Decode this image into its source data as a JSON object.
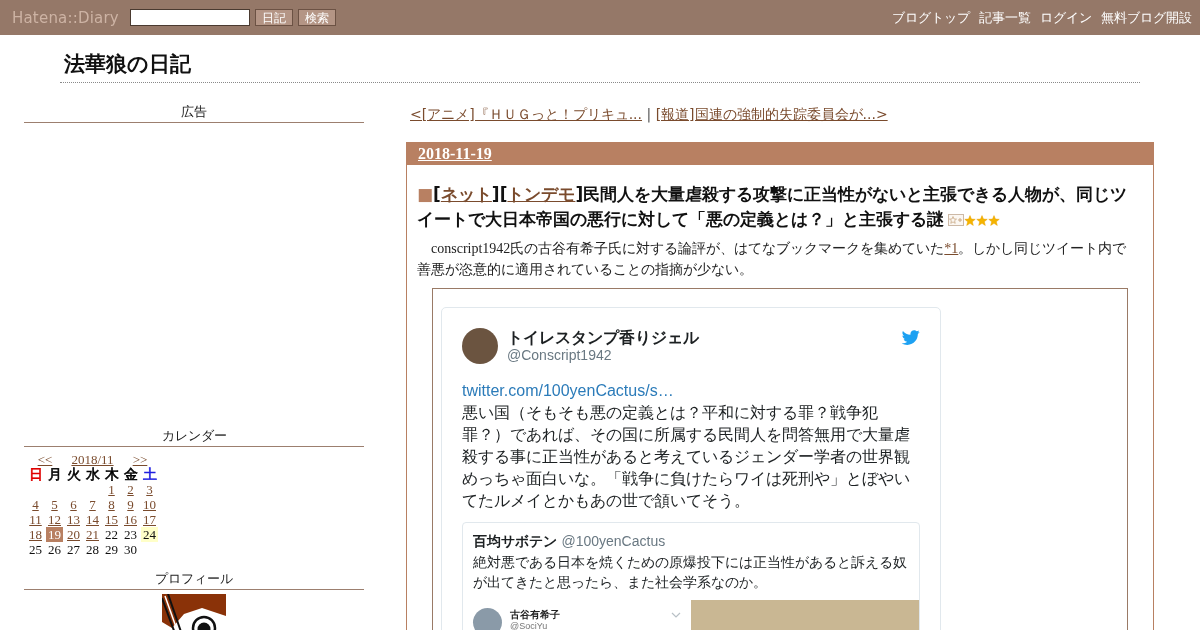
{
  "header": {
    "logo": "Hatena::Diary",
    "buttons": [
      "日記",
      "検索"
    ],
    "links": [
      "ブログトップ",
      "記事一覧",
      "ログイン",
      "無料ブログ開設"
    ]
  },
  "blog_title": "法華狼の日記",
  "sidebar": {
    "ad": {
      "heading": "広告"
    },
    "calendar": {
      "heading": "カレンダー",
      "prev": "<<",
      "month": "2018/11",
      "next": ">>",
      "weekdays": [
        {
          "label": "日",
          "color": "#e00000"
        },
        {
          "label": "月",
          "color": "#000000"
        },
        {
          "label": "火",
          "color": "#000000"
        },
        {
          "label": "水",
          "color": "#000000"
        },
        {
          "label": "木",
          "color": "#000000"
        },
        {
          "label": "金",
          "color": "#000000"
        },
        {
          "label": "土",
          "color": "#2020e0"
        }
      ],
      "weeks": [
        [
          {
            "day": "1",
            "linked": true,
            "selected": false,
            "today": false
          },
          {
            "day": "2",
            "linked": true,
            "selected": false,
            "today": false
          },
          {
            "day": "3",
            "linked": true,
            "selected": false,
            "today": false
          }
        ],
        [
          {
            "day": "4",
            "linked": true,
            "selected": false,
            "today": false
          },
          {
            "day": "5",
            "linked": true,
            "selected": false,
            "today": false
          },
          {
            "day": "6",
            "linked": true,
            "selected": false,
            "today": false
          },
          {
            "day": "7",
            "linked": true,
            "selected": false,
            "today": false
          },
          {
            "day": "8",
            "linked": true,
            "selected": false,
            "today": false
          },
          {
            "day": "9",
            "linked": true,
            "selected": false,
            "today": false
          },
          {
            "day": "10",
            "linked": true,
            "selected": false,
            "today": false
          }
        ],
        [
          {
            "day": "11",
            "linked": true,
            "selected": false,
            "today": false
          },
          {
            "day": "12",
            "linked": true,
            "selected": false,
            "today": false
          },
          {
            "day": "13",
            "linked": true,
            "selected": false,
            "today": false
          },
          {
            "day": "14",
            "linked": true,
            "selected": false,
            "today": false
          },
          {
            "day": "15",
            "linked": true,
            "selected": false,
            "today": false
          },
          {
            "day": "16",
            "linked": true,
            "selected": false,
            "today": false
          },
          {
            "day": "17",
            "linked": true,
            "selected": false,
            "today": false
          }
        ],
        [
          {
            "day": "18",
            "linked": true,
            "selected": false,
            "today": false
          },
          {
            "day": "19",
            "linked": true,
            "selected": true,
            "today": false
          },
          {
            "day": "20",
            "linked": true,
            "selected": false,
            "today": false
          },
          {
            "day": "21",
            "linked": true,
            "selected": false,
            "today": false
          },
          {
            "day": "22",
            "linked": false,
            "selected": false,
            "today": false
          },
          {
            "day": "23",
            "linked": false,
            "selected": false,
            "today": false
          },
          {
            "day": "24",
            "linked": false,
            "selected": false,
            "today": true
          }
        ],
        [
          {
            "day": "25",
            "linked": false,
            "selected": false,
            "today": false
          },
          {
            "day": "26",
            "linked": false,
            "selected": false,
            "today": false
          },
          {
            "day": "27",
            "linked": false,
            "selected": false,
            "today": false
          },
          {
            "day": "28",
            "linked": false,
            "selected": false,
            "today": false
          },
          {
            "day": "29",
            "linked": false,
            "selected": false,
            "today": false
          },
          {
            "day": "30",
            "linked": false,
            "selected": false,
            "today": false
          }
        ]
      ]
    },
    "profile": {
      "heading": "プロフィール"
    }
  },
  "pager": {
    "previous": "<[アニメ]『ＨＵＧっと！プリキュ...",
    "separator": "|",
    "next": "[報道]国連の強制的失踪委員会が...>"
  },
  "entry": {
    "date": "2018-11-19",
    "marker": "■",
    "categories": [
      {
        "open": "[",
        "label": "ネット",
        "close": "]"
      },
      {
        "open": "[",
        "label": "トンデモ",
        "close": "]"
      }
    ],
    "title": "民間人を大量虐殺する攻撃に正当性がないと主張できる人物が、同じツイートで大日本帝国の悪行に対して「悪の定義とは？」と主張する謎",
    "stars": 3,
    "body": {
      "before": "conscript1942氏の古谷有希子氏に対する論評が、はてなブックマークを集めていた",
      "footnote": "*1",
      "after": "。しかし同じツイート内で善悪が恣意的に適用されていることの指摘が少ない。"
    },
    "tweet": {
      "author": "トイレスタンプ香りジェル",
      "handle": "@Conscript1942",
      "link": "twitter.com/100yenCactus/s…",
      "text": "悪い国（そもそも悪の定義とは？平和に対する罪？戦争犯罪？）であれば、その国に所属する民間人を問答無用で大量虐殺する事に正当性があると考えているジェンダー学者の世界観めっちゃ面白いな。「戦争に負けたらワイは死刑や」とぼやいてたルメイとかもあの世で頷いてそう。",
      "quote": {
        "author": "百均サボテン",
        "handle": "@100yenCactus",
        "text": "絶対悪である日本を焼くための原爆投下には正当性があると訴える奴が出てきたと思ったら、また社会学系なのか。",
        "media_author": "古谷有希子",
        "media_handle": "@SociYu"
      }
    }
  }
}
